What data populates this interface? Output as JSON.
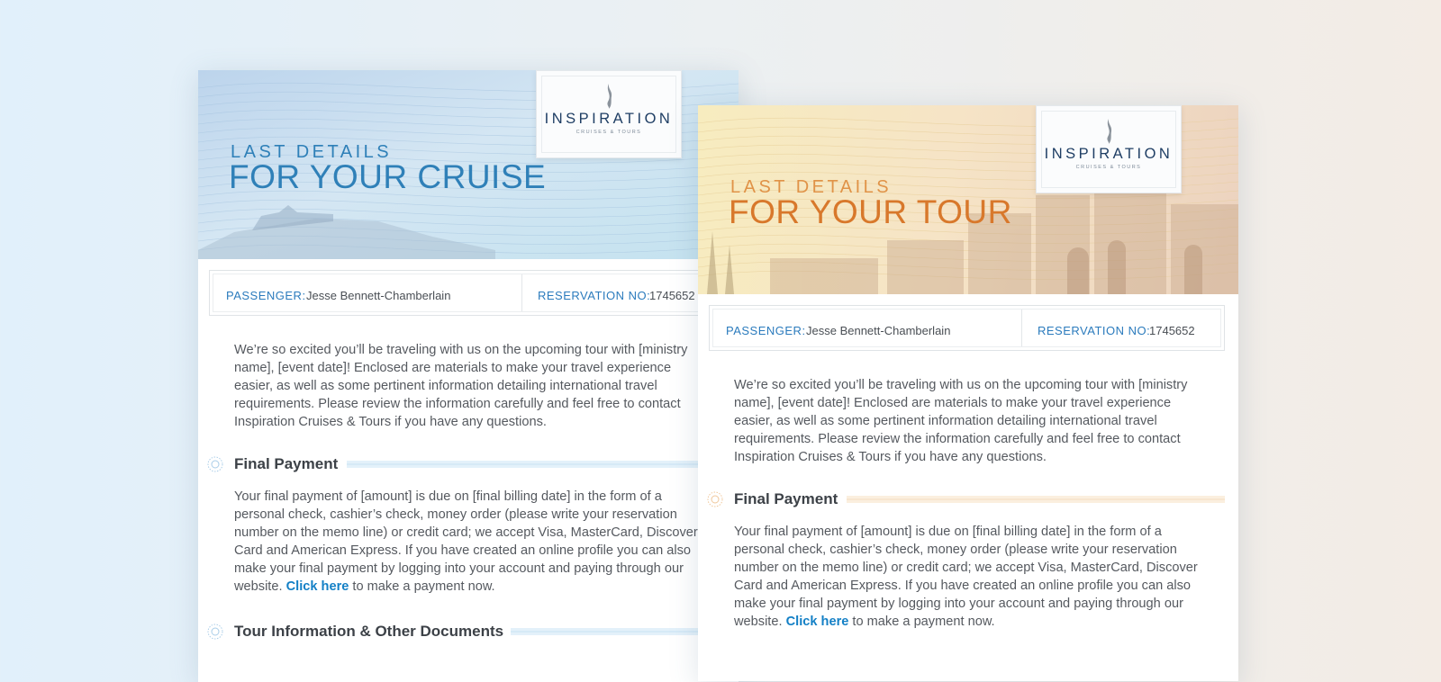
{
  "brand": {
    "name": "INSPIRATION",
    "tagline": "CRUISES & TOURS",
    "colors": {
      "blue": "#2f80b8",
      "orange": "#d8782b",
      "navy": "#1f3e64",
      "link": "#1480c6"
    }
  },
  "cruise": {
    "kicker": "LAST DETAILS",
    "headline": "FOR YOUR CRUISE",
    "passenger_label": "PASSENGER:",
    "passenger_name": "Jesse Bennett-Chamberlain",
    "reservation_label": "RESERVATION NO:",
    "reservation_no": "1745652",
    "intro": "We’re so excited you’ll be traveling with us on the upcoming tour with [ministry name], [event date]! Enclosed are materials to make your travel experience easier, as well as some pertinent information detailing international travel requirements. Please review the information carefully and feel free to contact Inspiration Cruises & Tours if you have any questions.",
    "final_payment_title": "Final Payment",
    "final_payment_text": "Your final payment of [amount] is due on [final billing date] in the form of a personal check, cashier’s check, money order (please write your reservation number on the memo line) or credit card; we accept Visa, MasterCard, Discover Card and American Express. If you have created an online profile you can also make your final payment by logging into your account and paying through our website.",
    "click_here": "Click here",
    "after_link": " to make a payment now.",
    "tour_info_title": "Tour Information & Other Documents"
  },
  "tour": {
    "kicker": "LAST DETAILS",
    "headline": "FOR YOUR TOUR",
    "passenger_label": "PASSENGER:",
    "passenger_name": "Jesse Bennett-Chamberlain",
    "reservation_label": "RESERVATION NO:",
    "reservation_no": "1745652",
    "intro": "We’re so excited you’ll be traveling with us on the upcoming tour with [ministry name], [event date]! Enclosed are materials to make your travel experience easier, as well as some pertinent information detailing international travel requirements. Please review the information carefully and feel free to contact Inspiration Cruises & Tours if you have any questions.",
    "final_payment_title": "Final Payment",
    "final_payment_text": "Your final payment of [amount] is due on [final billing date] in the form of a personal check, cashier’s check, money order (please write your reservation number on the memo line) or credit card; we accept Visa, MasterCard, Discover Card and American Express. If you have created an online profile you can also make your final payment by logging into your account and paying through our website.",
    "click_here": "Click here",
    "after_link": " to make a payment now."
  }
}
